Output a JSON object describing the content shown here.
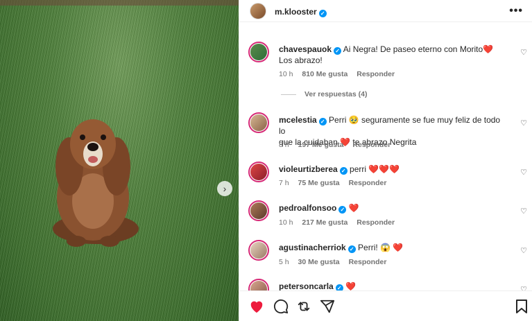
{
  "post": {
    "author": "m.klooster",
    "more_label": "•••"
  },
  "media": {
    "next_label": "›"
  },
  "comments": [
    {
      "user": "chavespauok",
      "text": "Ai Negra! De paseo eterno con Morito",
      "text2": "Los abrazo!",
      "time": "10 h",
      "likes": "810 Me gusta",
      "reply": "Responder"
    },
    {
      "user": "mcelestia",
      "text": "Perri 🥹 seguramente se fue muy feliz de todo lo",
      "text2": "que la cuidaban",
      "text3": "te abrazo Negrita",
      "time": "8 h",
      "likes": "197 Me gusta",
      "reply": "Responder"
    },
    {
      "user": "violeurtizberea",
      "text": "perri",
      "time": "7 h",
      "likes": "75 Me gusta",
      "reply": "Responder"
    },
    {
      "user": "pedroalfonsoo",
      "text": "",
      "time": "10 h",
      "likes": "217 Me gusta",
      "reply": "Responder"
    },
    {
      "user": "agustinacherriok",
      "text": "Perri! 😱",
      "time": "5 h",
      "likes": "30 Me gusta",
      "reply": "Responder"
    },
    {
      "user": "petersoncarla",
      "text": ""
    }
  ],
  "view_replies": "Ver respuestas (4)",
  "colors": {
    "verified": "#0095f6",
    "like": "#ed1c3d",
    "story_ring": "#d62976"
  },
  "icons": [
    "heart-icon",
    "comment-icon",
    "share-icon",
    "send-icon",
    "bookmark-icon"
  ]
}
